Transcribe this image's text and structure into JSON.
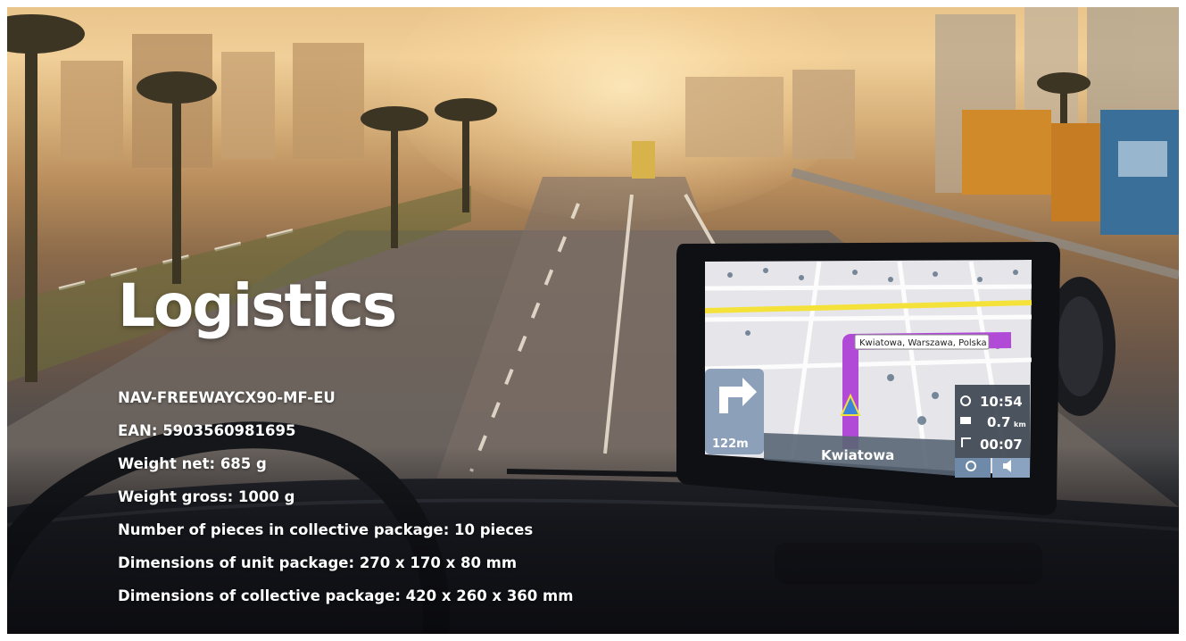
{
  "hero": {
    "title": "Logistics",
    "specs": [
      "NAV-FREEWAYCX90-MF-EU",
      "EAN: 5903560981695",
      "Weight net: 685 g",
      "Weight gross: 1000 g",
      "Number of pieces in collective package: 10 pieces",
      "Dimensions of unit package: 270 x 170 x 80 mm",
      "Dimensions of collective package: 420 x 260 x 360 mm"
    ]
  },
  "gps_device": {
    "address_label": "Kwiatowa, Warszawa, Polska",
    "street_name": "Kwiatowa",
    "turn_distance": "122m",
    "eta_time": "10:54",
    "remaining_distance": "0.7",
    "remaining_distance_unit": "km",
    "remaining_time": "00:07",
    "icons": [
      "turn-right-arrow-icon",
      "clock-icon",
      "flag-icon",
      "route-icon",
      "search-icon",
      "volume-icon",
      "position-marker-icon"
    ]
  },
  "colors": {
    "route_purple": "#b24ad8",
    "main_road_yellow": "#f4e23a",
    "map_background": "#e6e6ea",
    "text_white": "#ffffff"
  }
}
